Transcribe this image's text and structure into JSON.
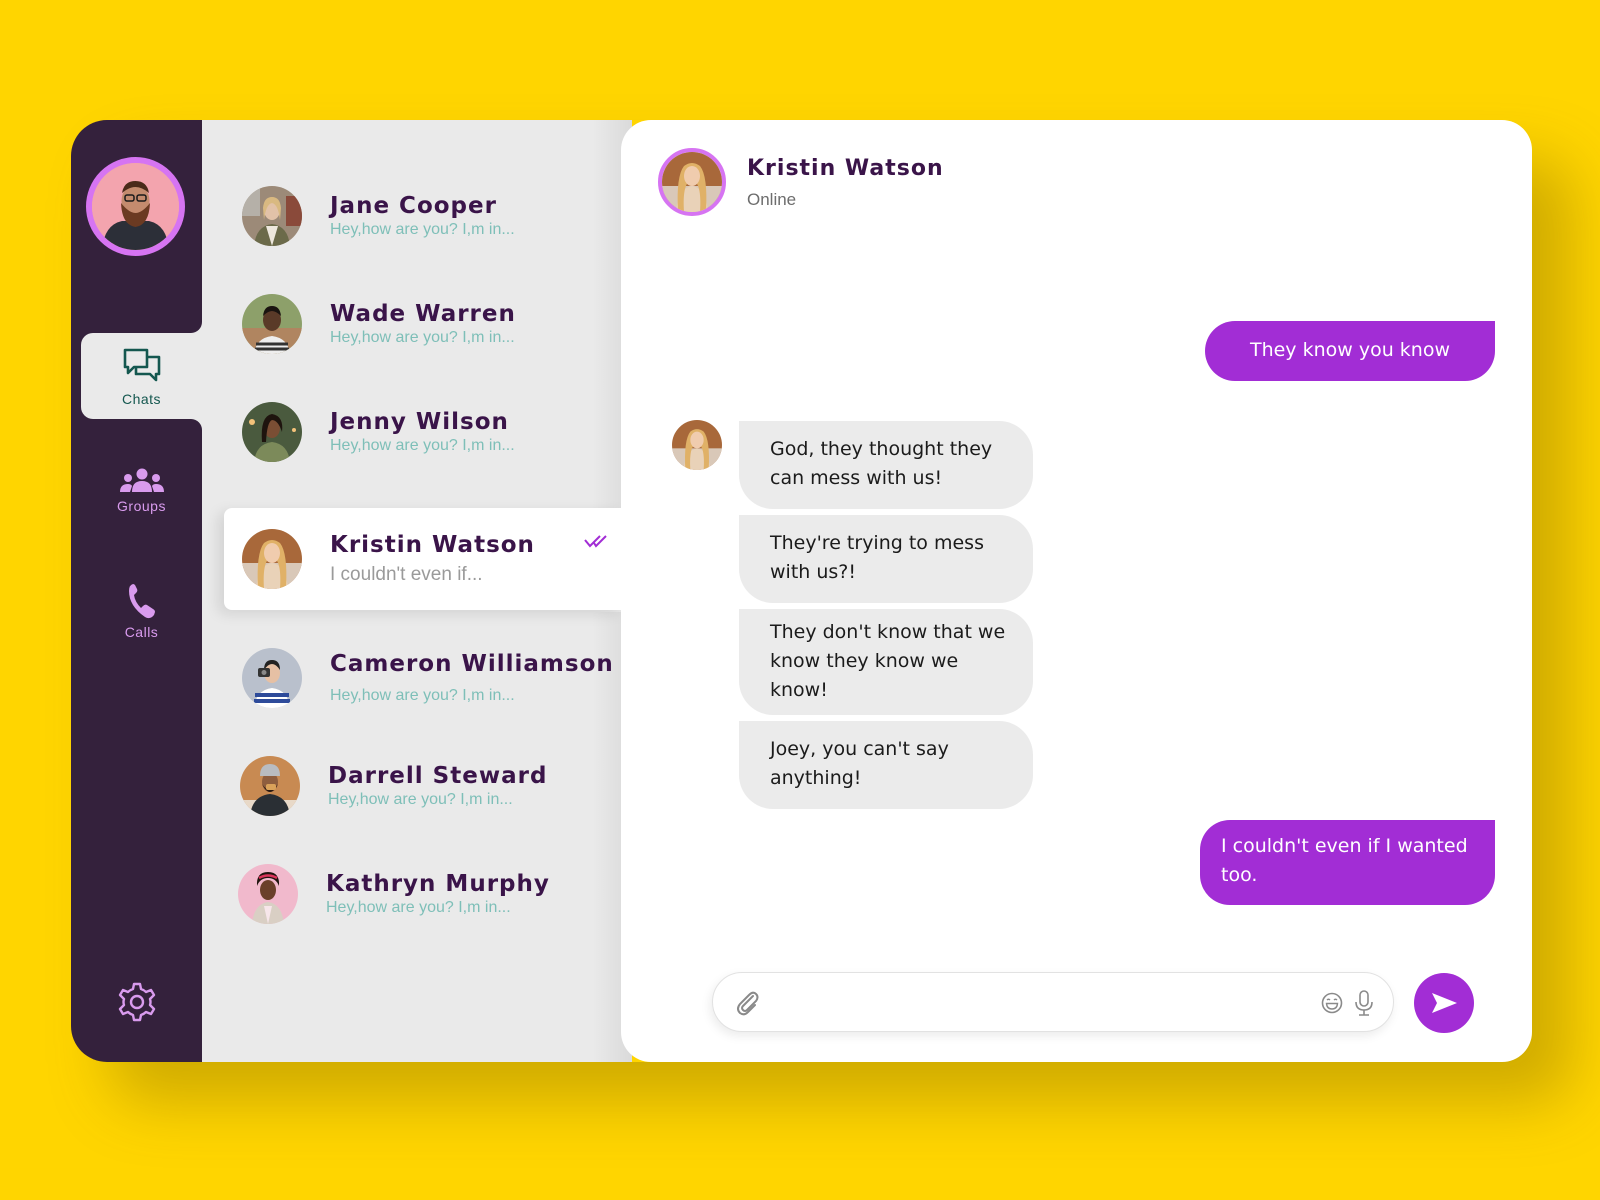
{
  "colors": {
    "background": "#FFD500",
    "sidebar": "#34213C",
    "accent": "#A22DD5",
    "avatar_ring": "#D674F2",
    "name_text": "#3A1449",
    "preview_text": "#7EBFB8",
    "received_bubble": "#EBEBEB",
    "active_nav_text": "#14574F"
  },
  "sidebar": {
    "user_avatar": "current-user-avatar",
    "nav": [
      {
        "label": "Chats",
        "icon": "chat-bubbles-icon",
        "active": true
      },
      {
        "label": "Groups",
        "icon": "group-icon",
        "active": false
      },
      {
        "label": "Calls",
        "icon": "phone-icon",
        "active": false
      }
    ],
    "settings_icon": "gear-icon"
  },
  "chat_list": [
    {
      "name": "Jane Cooper",
      "preview": "Hey,how are you? I,m in...",
      "avatar_color": "#8A7A6A"
    },
    {
      "name": "Wade Warren",
      "preview": "Hey,how are you? I,m in...",
      "avatar_color": "#6F5A44"
    },
    {
      "name": "Jenny Wilson",
      "preview": "Hey,how are you? I,m in...",
      "avatar_color": "#4E5A3E"
    },
    {
      "name": "Kristin Watson",
      "preview": "I couldn't even if...",
      "avatar_color": "#C98A4F",
      "selected": true,
      "read": true
    },
    {
      "name": "Cameron Williamson",
      "preview": "Hey,how are you? I,m in...",
      "avatar_color": "#5A6D9A"
    },
    {
      "name": "Darrell Steward",
      "preview": "Hey,how are you? I,m in...",
      "avatar_color": "#7A6250"
    },
    {
      "name": "Kathryn Murphy",
      "preview": "Hey,how are you? I,m in...",
      "avatar_color": "#F1B9CC"
    }
  ],
  "conversation": {
    "contact_name": "Kristin Watson",
    "status": "Online",
    "messages": [
      {
        "direction": "out",
        "text": "They know you know"
      },
      {
        "direction": "in",
        "text": "God, they thought they can mess with us!"
      },
      {
        "direction": "in",
        "text": "They're trying to mess with us?!"
      },
      {
        "direction": "in",
        "text": "They don't know that we know they know we know!"
      },
      {
        "direction": "in",
        "text": "Joey, you can't say anything!"
      },
      {
        "direction": "out",
        "text": "I couldn't even if I wanted too."
      }
    ]
  },
  "composer": {
    "value": "",
    "placeholder": "",
    "attach_icon": "paperclip-icon",
    "emoji_icon": "emoji-icon",
    "mic_icon": "microphone-icon",
    "send_icon": "send-icon"
  }
}
